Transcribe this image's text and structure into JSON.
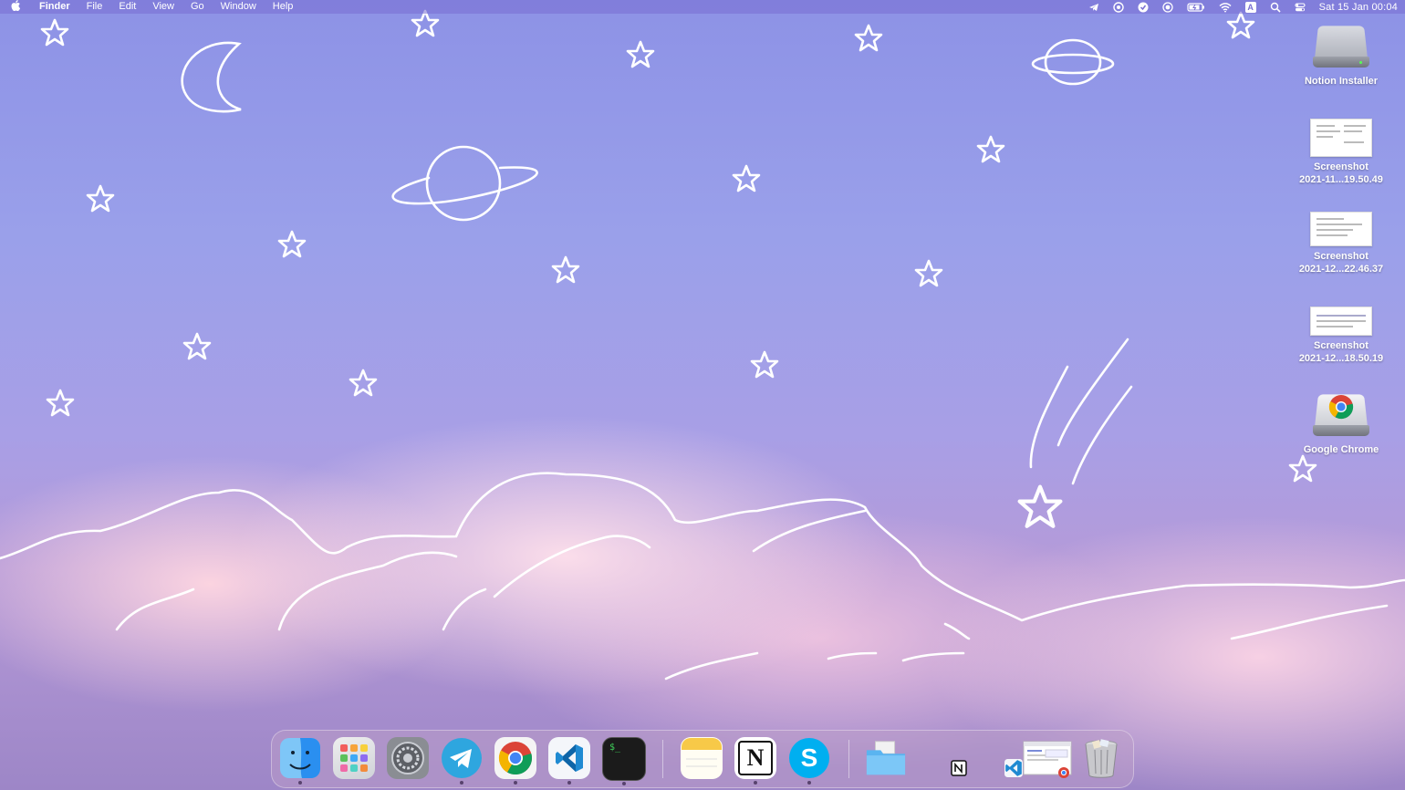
{
  "menubar": {
    "apple_icon": "apple-logo-icon",
    "items": [
      "Finder",
      "File",
      "Edit",
      "View",
      "Go",
      "Window",
      "Help"
    ],
    "status_icons": [
      "telegram-status-icon",
      "focus-icon",
      "tasks-check-icon",
      "screen-record-icon",
      "battery-charging-icon",
      "wifi-icon",
      "input-source-icon",
      "spotlight-search-icon",
      "control-center-icon"
    ],
    "input_source_label": "A",
    "clock": "Sat 15 Jan  00:04"
  },
  "desktop": {
    "icons": [
      {
        "name": "Notion Installer",
        "line2": ""
      },
      {
        "name": "Screenshot",
        "line2": "2021-11...19.50.49"
      },
      {
        "name": "Screenshot",
        "line2": "2021-12...22.46.37"
      },
      {
        "name": "Screenshot",
        "line2": "2021-12...18.50.19"
      },
      {
        "name": "Google Chrome",
        "line2": ""
      }
    ]
  },
  "dock": {
    "apps": [
      "Finder",
      "Launchpad",
      "System Preferences",
      "Telegram",
      "Google Chrome",
      "Visual Studio Code",
      "Terminal",
      "Notes",
      "Notion",
      "Skype"
    ],
    "others": [
      "Downloads folder",
      "Notion window",
      "Visual Studio Code window",
      "Chrome window",
      "Trash"
    ],
    "terminal_prompt": "$_",
    "notion_letter": "N",
    "skype_letter": "S"
  },
  "colors": {
    "sky_top": "#8d92e6",
    "cloud_pink": "#ffd7e6",
    "menubar": "#786ed2"
  }
}
